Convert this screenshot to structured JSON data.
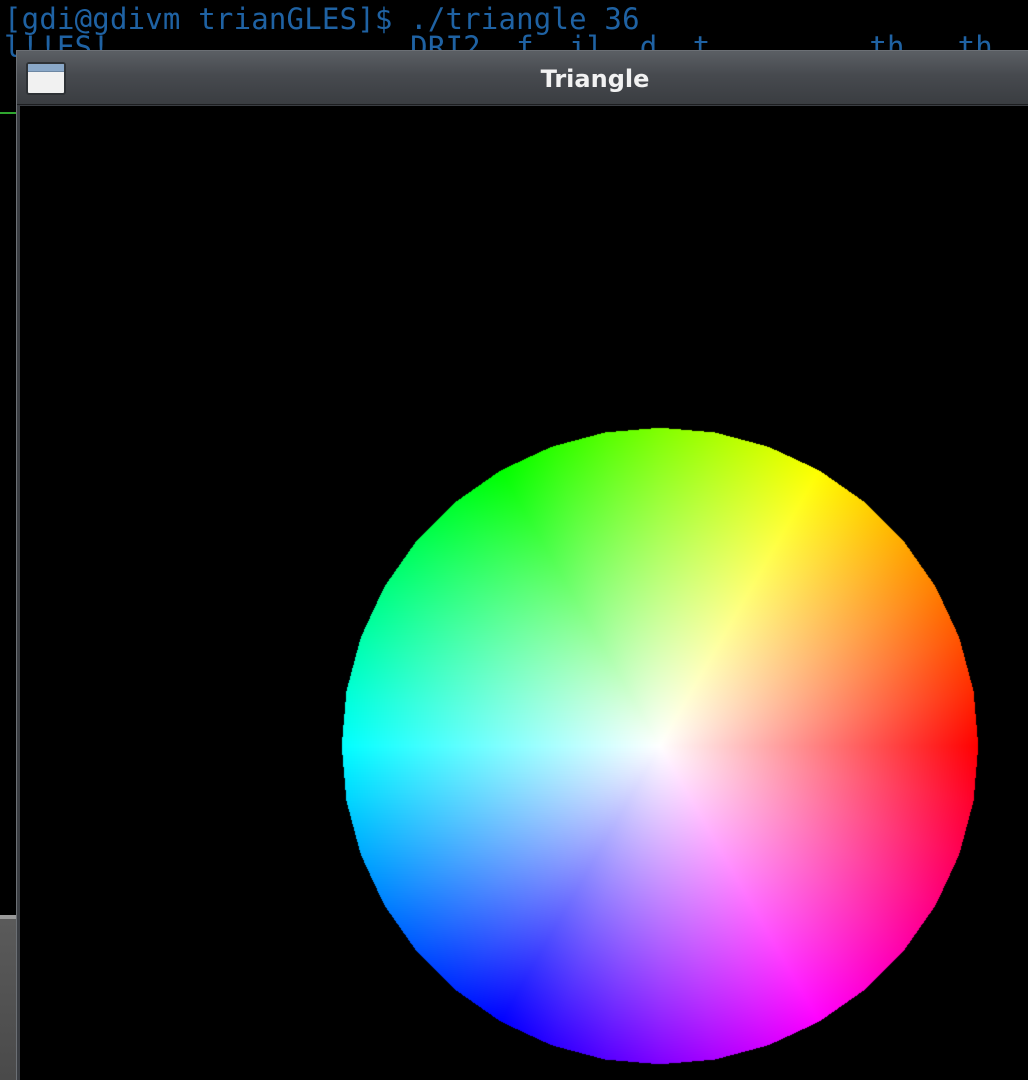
{
  "terminal": {
    "prompt_line": "[gdi@gdivm trianGLES]$ ./triangle 36",
    "partial_line": "l!!ES!                 DRI2  f  il  d  t         th   th  t",
    "text_color": "#1f62a3"
  },
  "window": {
    "title": "Triangle",
    "menu_icon": "window-menu-icon",
    "title_color": "#f2f2f2"
  },
  "gl_render": {
    "shape": "triangle-fan color wheel",
    "segments": 36,
    "background": "#000000",
    "center_color": "#ffffff",
    "rim_hues": [
      "#ff0000",
      "#ffff00",
      "#00ff00",
      "#00ffff",
      "#0000ff",
      "#ff00ff"
    ]
  }
}
